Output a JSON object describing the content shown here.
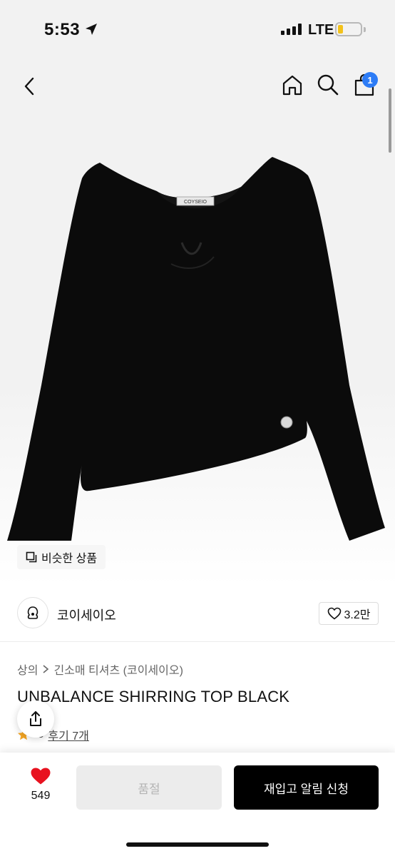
{
  "status_bar": {
    "time": "5:53",
    "network": "LTE",
    "battery_color": "#f3c21b"
  },
  "header": {
    "back_icon": "chevron-left-icon",
    "home_icon": "home-icon",
    "search_icon": "search-icon",
    "cart_icon": "shopping-bag-icon",
    "cart_count": "1",
    "badge_color": "#2d7cf6"
  },
  "product_image": {
    "label_tag": "COYSEIO"
  },
  "similar_button": {
    "icon": "copy-icon",
    "label": "비슷한 상품"
  },
  "seller": {
    "name": "코이세이오",
    "likes": "3.2만",
    "like_icon": "heart-outline-icon"
  },
  "product": {
    "breadcrumb": [
      "상의",
      "긴소매 티셔츠 (코이세이오)"
    ],
    "title": "UNBALANCE SHIRRING TOP BLACK",
    "rating": ".8",
    "reviews": "후기 7개"
  },
  "bottom_bar": {
    "wish_count": "549",
    "soldout_label": "품절",
    "restock_label": "재입고 알림 신청",
    "accent": "#000000",
    "wish_color": "#e8121f"
  }
}
